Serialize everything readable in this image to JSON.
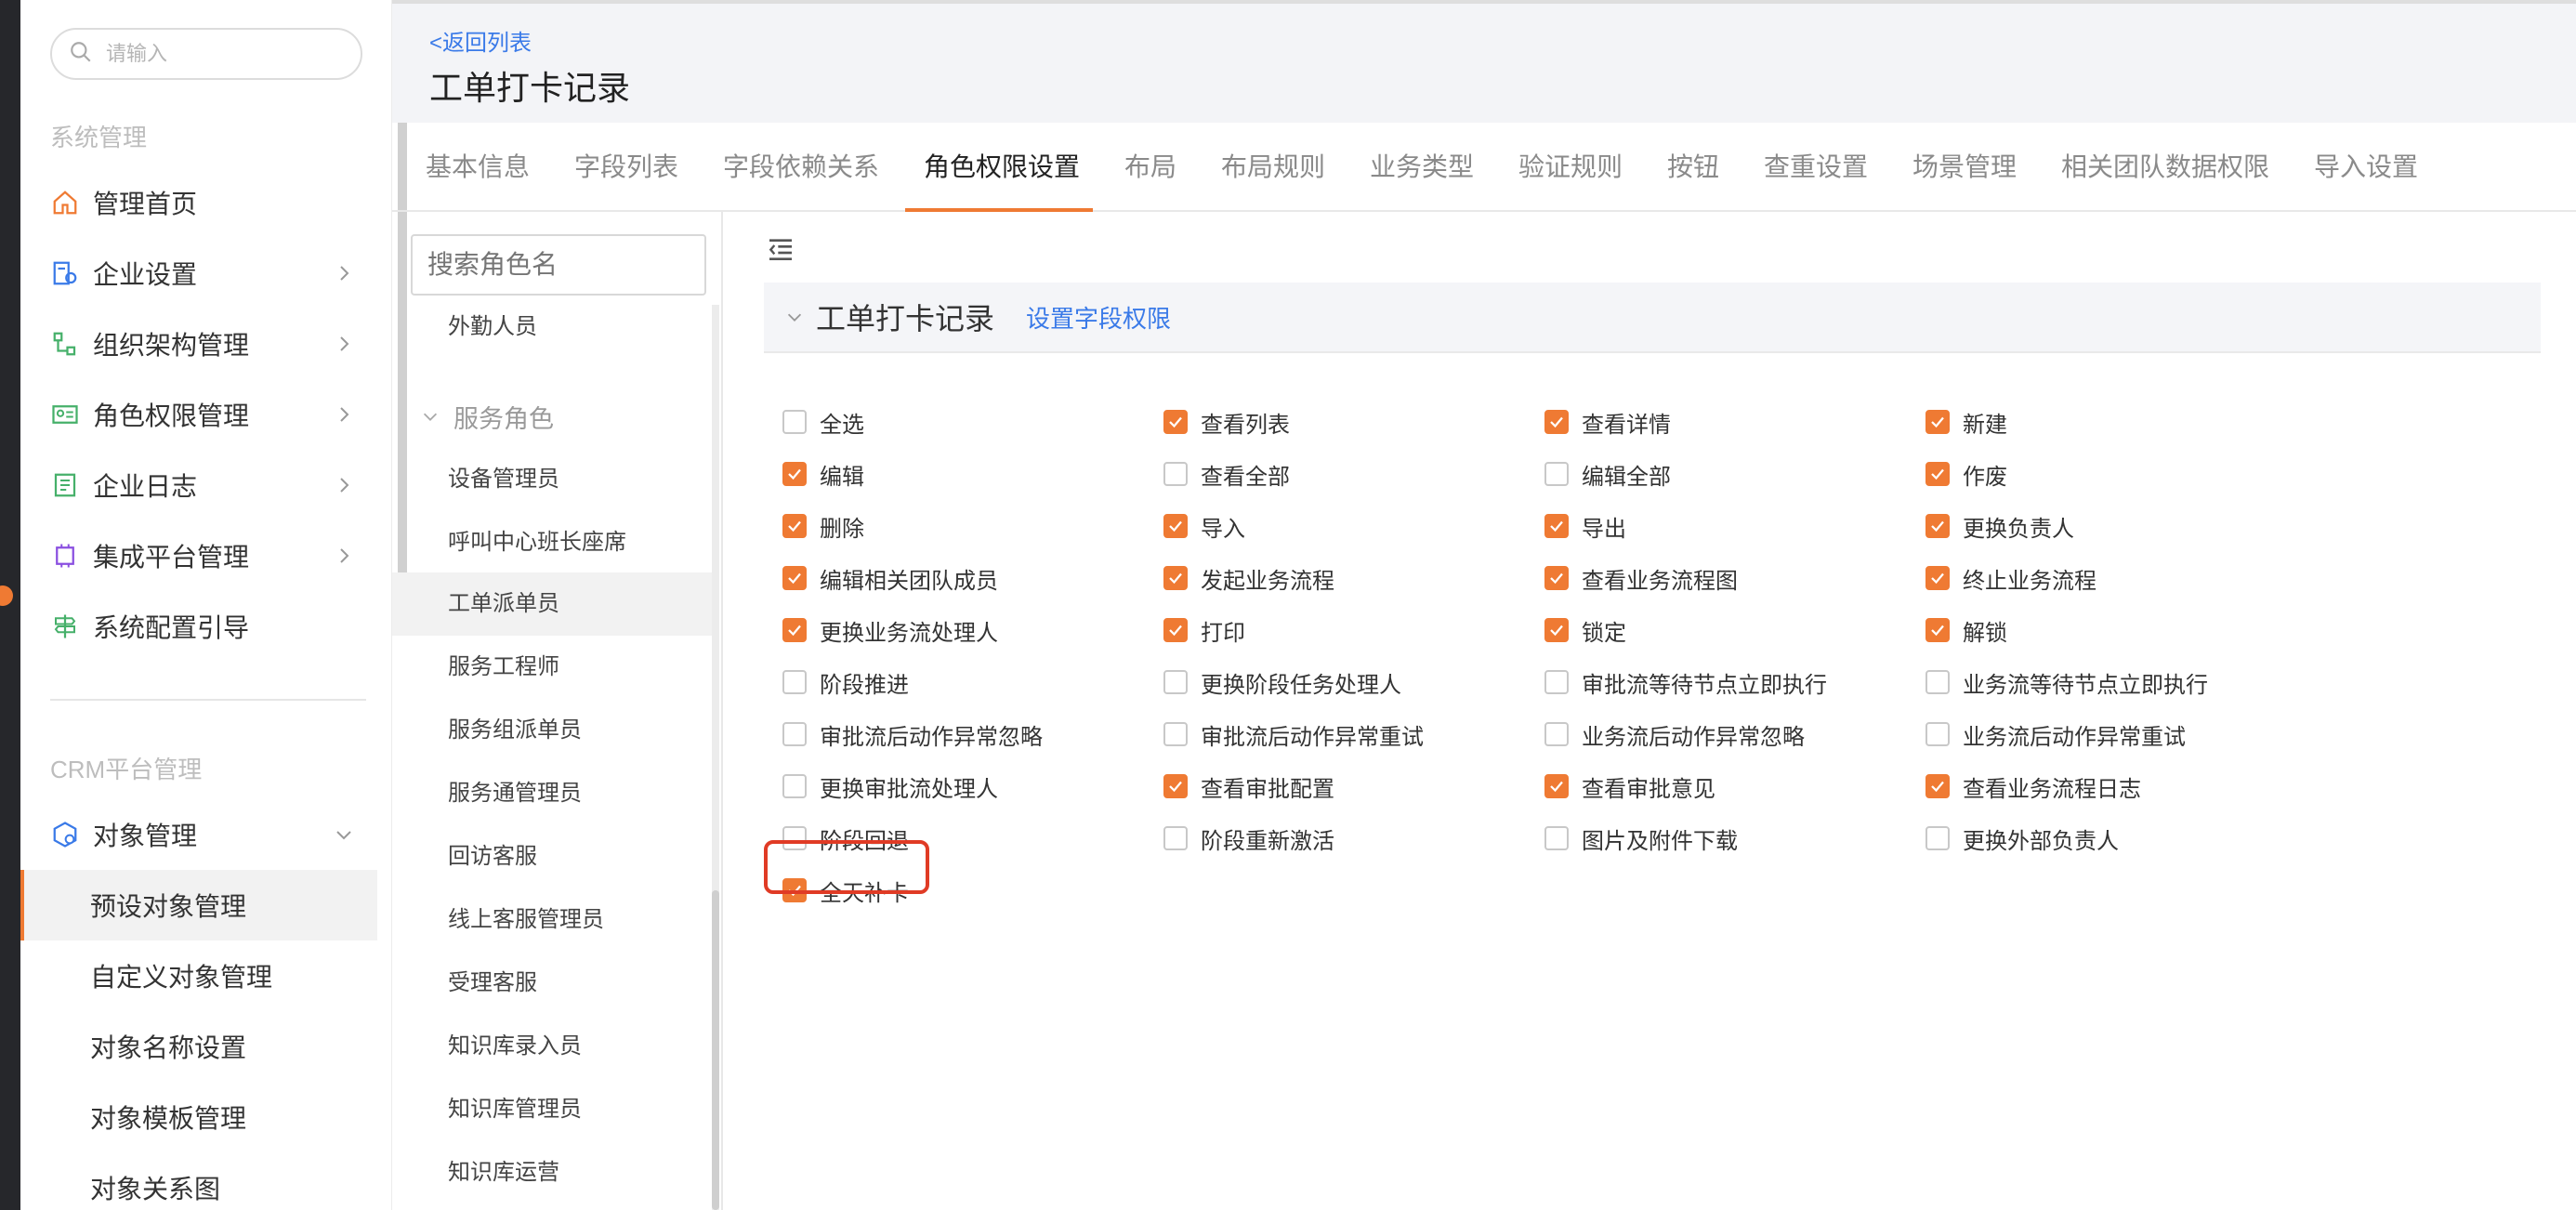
{
  "colors": {
    "accent": "#ef7a33",
    "link": "#3a7ae8",
    "highlight": "#e03b25"
  },
  "sidebar": {
    "search_placeholder": "请输入",
    "system_section": "系统管理",
    "system_items": [
      {
        "label": "管理首页",
        "icon": "home-icon"
      },
      {
        "label": "企业设置",
        "icon": "enterprise-settings-icon"
      },
      {
        "label": "组织架构管理",
        "icon": "org-structure-icon"
      },
      {
        "label": "角色权限管理",
        "icon": "role-card-icon"
      },
      {
        "label": "企业日志",
        "icon": "log-icon"
      },
      {
        "label": "集成平台管理",
        "icon": "chip-icon"
      },
      {
        "label": "系统配置引导",
        "icon": "signpost-icon"
      }
    ],
    "crm_section": "CRM平台管理",
    "object_management": {
      "label": "对象管理",
      "icon": "object-settings-icon"
    },
    "sub_items": [
      "预设对象管理",
      "自定义对象管理",
      "对象名称设置",
      "对象模板管理",
      "对象关系图"
    ]
  },
  "header": {
    "back_link": "<返回列表",
    "title": "工单打卡记录"
  },
  "tabs": [
    "基本信息",
    "字段列表",
    "字段依赖关系",
    "角色权限设置",
    "布局",
    "布局规则",
    "业务类型",
    "验证规则",
    "按钮",
    "查重设置",
    "场景管理",
    "相关团队数据权限",
    "导入设置"
  ],
  "roles": {
    "search_placeholder": "搜索角色名",
    "top_item": "外勤人员",
    "group": "服务角色",
    "items": [
      "设备管理员",
      "呼叫中心班长座席",
      "工单派单员",
      "服务工程师",
      "服务组派单员",
      "服务通管理员",
      "回访客服",
      "线上客服管理员",
      "受理客服",
      "知识库录入员",
      "知识库管理员",
      "知识库运营"
    ]
  },
  "permissions": {
    "section_title": "工单打卡记录",
    "section_link": "设置字段权限",
    "rows": [
      [
        {
          "label": "全选",
          "checked": false
        },
        {
          "label": "查看列表",
          "checked": true
        },
        {
          "label": "查看详情",
          "checked": true
        },
        {
          "label": "新建",
          "checked": true
        }
      ],
      [
        {
          "label": "编辑",
          "checked": true
        },
        {
          "label": "查看全部",
          "checked": false
        },
        {
          "label": "编辑全部",
          "checked": false
        },
        {
          "label": "作废",
          "checked": true
        }
      ],
      [
        {
          "label": "删除",
          "checked": true
        },
        {
          "label": "导入",
          "checked": true
        },
        {
          "label": "导出",
          "checked": true
        },
        {
          "label": "更换负责人",
          "checked": true
        }
      ],
      [
        {
          "label": "编辑相关团队成员",
          "checked": true
        },
        {
          "label": "发起业务流程",
          "checked": true
        },
        {
          "label": "查看业务流程图",
          "checked": true
        },
        {
          "label": "终止业务流程",
          "checked": true
        }
      ],
      [
        {
          "label": "更换业务流处理人",
          "checked": true
        },
        {
          "label": "打印",
          "checked": true
        },
        {
          "label": "锁定",
          "checked": true
        },
        {
          "label": "解锁",
          "checked": true
        }
      ],
      [
        {
          "label": "阶段推进",
          "checked": false
        },
        {
          "label": "更换阶段任务处理人",
          "checked": false
        },
        {
          "label": "审批流等待节点立即执行",
          "checked": false
        },
        {
          "label": "业务流等待节点立即执行",
          "checked": false
        }
      ],
      [
        {
          "label": "审批流后动作异常忽略",
          "checked": false
        },
        {
          "label": "审批流后动作异常重试",
          "checked": false
        },
        {
          "label": "业务流后动作异常忽略",
          "checked": false
        },
        {
          "label": "业务流后动作异常重试",
          "checked": false
        }
      ],
      [
        {
          "label": "更换审批流处理人",
          "checked": false
        },
        {
          "label": "查看审批配置",
          "checked": true
        },
        {
          "label": "查看审批意见",
          "checked": true
        },
        {
          "label": "查看业务流程日志",
          "checked": true
        }
      ],
      [
        {
          "label": "阶段回退",
          "checked": false
        },
        {
          "label": "阶段重新激活",
          "checked": false
        },
        {
          "label": "图片及附件下载",
          "checked": false
        },
        {
          "label": "更换外部负责人",
          "checked": false
        }
      ],
      [
        {
          "label": "全天补卡",
          "checked": true
        }
      ]
    ]
  }
}
